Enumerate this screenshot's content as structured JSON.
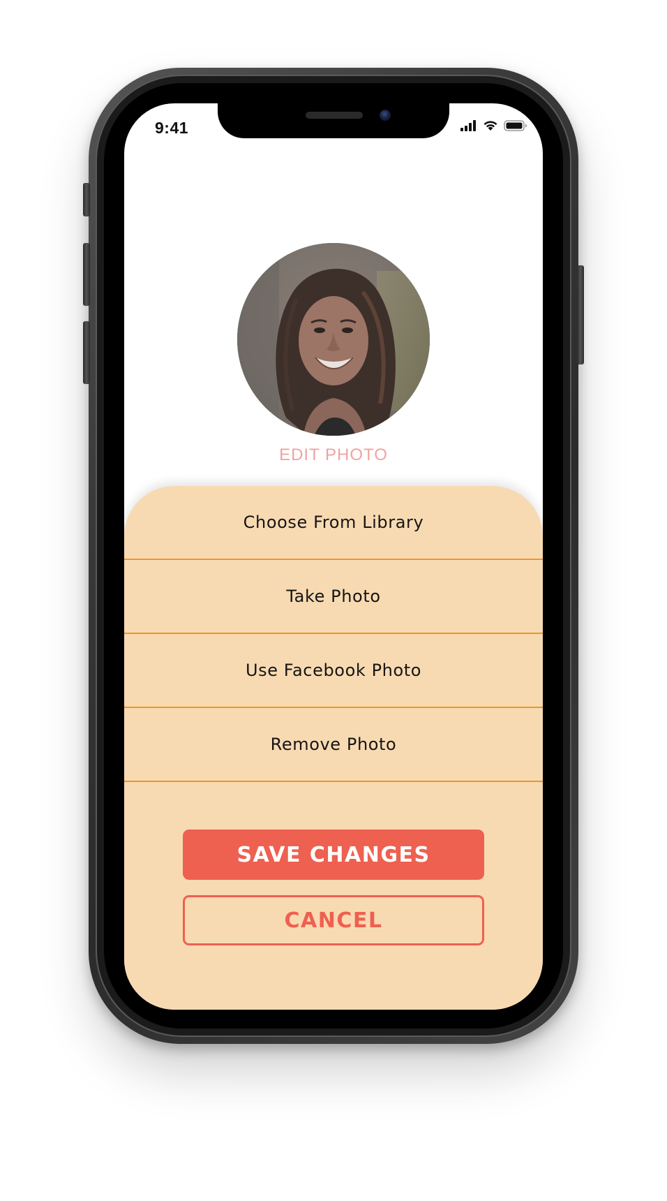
{
  "status_bar": {
    "time": "9:41",
    "icons": [
      "cellular-signal-icon",
      "wifi-icon",
      "battery-icon"
    ]
  },
  "profile": {
    "avatar_icon": "profile-photo",
    "edit_photo_label": "EDIT PHOTO"
  },
  "action_sheet": {
    "options": [
      {
        "label": "Choose From Library"
      },
      {
        "label": "Take Photo"
      },
      {
        "label": "Use Facebook Photo"
      },
      {
        "label": "Remove Photo"
      }
    ],
    "save_label": "SAVE CHANGES",
    "cancel_label": "CANCEL"
  },
  "colors": {
    "sheet_background": "#f8dab2",
    "divider": "#f0961e",
    "accent": "#ee6050",
    "edit_photo_text": "#f0a3a0"
  }
}
